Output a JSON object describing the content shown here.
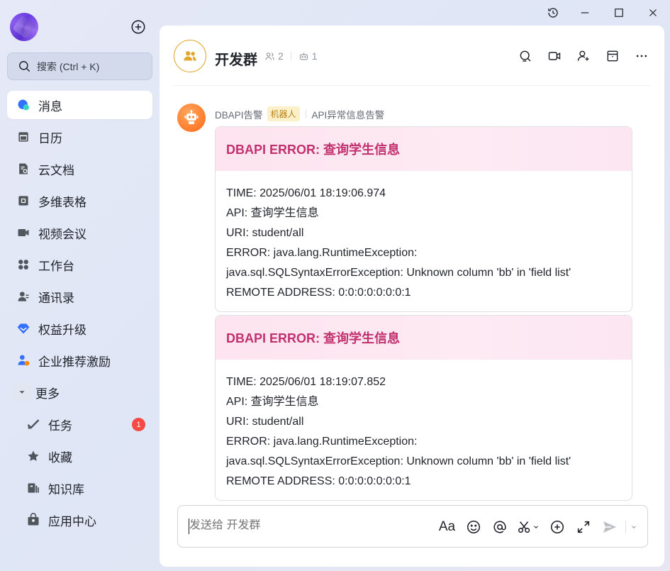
{
  "sidebar": {
    "search_placeholder": "搜索 (Ctrl + K)",
    "items": [
      {
        "label": "消息",
        "icon": "chat-bubble-icon",
        "active": true
      },
      {
        "label": "日历",
        "icon": "calendar-icon"
      },
      {
        "label": "云文档",
        "icon": "cloud-doc-icon"
      },
      {
        "label": "多维表格",
        "icon": "base-table-icon"
      },
      {
        "label": "视频会议",
        "icon": "video-icon"
      },
      {
        "label": "工作台",
        "icon": "workplace-icon"
      },
      {
        "label": "通讯录",
        "icon": "contacts-icon"
      },
      {
        "label": "权益升级",
        "icon": "diamond-icon"
      },
      {
        "label": "企业推荐激励",
        "icon": "referral-icon"
      },
      {
        "label": "更多",
        "icon": "chevron-down-icon"
      }
    ],
    "sub_items": [
      {
        "label": "任务",
        "icon": "task-icon",
        "badge": "1"
      },
      {
        "label": "收藏",
        "icon": "star-icon"
      },
      {
        "label": "知识库",
        "icon": "wiki-icon"
      },
      {
        "label": "应用中心",
        "icon": "app-center-icon"
      }
    ]
  },
  "chat_header": {
    "group_name": "开发群",
    "member_count": "2",
    "bot_count": "1"
  },
  "message": {
    "sender": "DBAPI告警",
    "sender_tag": "机器人",
    "sender_desc": "API异常信息告警",
    "cards": [
      {
        "title": "DBAPI ERROR: 查询学生信息",
        "lines": [
          "TIME: 2025/06/01 18:19:06.974",
          "API: 查询学生信息",
          "URI: student/all",
          "ERROR: java.lang.RuntimeException:",
          "java.sql.SQLSyntaxErrorException: Unknown column 'bb' in 'field list'",
          "REMOTE ADDRESS: 0:0:0:0:0:0:0:1"
        ]
      },
      {
        "title": "DBAPI ERROR: 查询学生信息",
        "lines": [
          "TIME: 2025/06/01 18:19:07.852",
          "API: 查询学生信息",
          "URI: student/all",
          "ERROR: java.lang.RuntimeException:",
          "java.sql.SQLSyntaxErrorException: Unknown column 'bb' in 'field list'",
          "REMOTE ADDRESS: 0:0:0:0:0:0:0:1"
        ]
      }
    ]
  },
  "composer": {
    "placeholder": "发送给 开发群",
    "format_label": "Aa"
  },
  "colors": {
    "card_title": "#c1306f",
    "card_header_bg": "#fde4ef",
    "badge": "#f54a45",
    "bot_tag_bg": "#fcf0c8",
    "bot_avatar": "#ff7a2a",
    "group_avatar_border": "#e1a62b"
  }
}
